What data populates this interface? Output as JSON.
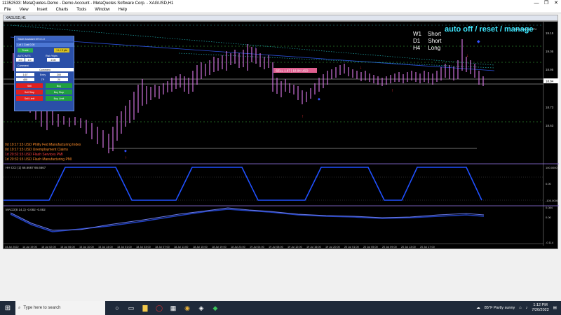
{
  "window": {
    "title": "11352533: MetaQuotes-Demo - Demo Account - MetaQuotes Software Corp. - XAGUSD,H1",
    "controls": [
      "—",
      "❐",
      "✕"
    ]
  },
  "menu": [
    "File",
    "View",
    "Insert",
    "Charts",
    "Tools",
    "Window",
    "Help"
  ],
  "chart": {
    "tab_title": "XAGUSD,H1",
    "trade_assist_label": "Trade Assistant MT4",
    "timeframes": [
      {
        "tf": "W1",
        "bias": "Short"
      },
      {
        "tf": "D1",
        "bias": "Short"
      },
      {
        "tf": "H4",
        "bias": "Long"
      }
    ],
    "auto_label": "auto off / reset / manage",
    "sell_label": "SELL 1.67 | 18.94 USD",
    "price_axis": [
      "19.15",
      "19.05",
      "18.95",
      "18.84",
      "18.73",
      "18.63"
    ],
    "current_price": "18.84",
    "cci_label": "HH CCI (1) 66.6667 66.6667",
    "cci_axis": [
      "100.0000",
      "0.00",
      "-100.0000"
    ],
    "macd_label": "MACD(8 14,1) -0.082 -0.082",
    "macd_axis": [
      "0.084",
      "0.00",
      "-0.114"
    ],
    "time_axis": [
      "14 Jul 2022",
      "14 Jul 19:00",
      "15 Jul 02:00",
      "15 Jul 06:00",
      "15 Jul 10:00",
      "15 Jul 14:00",
      "18 Jul 01:00",
      "18 Jul 03:00",
      "18 Jul 07:00",
      "18 Jul 11:00",
      "18 Jul 15:00",
      "18 Jul 19:00",
      "18 Jul 23:00",
      "19 Jul 04:00",
      "19 Jul 08:00",
      "19 Jul 12:00",
      "19 Jul 16:00",
      "19 Jul 20:00",
      "20 Jul 01:00",
      "20 Jul 05:00",
      "20 Jul 09:00",
      "20 Jul 13:00",
      "20 Jul 17:00"
    ]
  },
  "panel": {
    "title": "Trade Assistant MT4 1.0",
    "lot_label": "Lot 1  Cost 0.00",
    "trade_btn": "Trade",
    "lot_btn": "1 L / 2 pts",
    "sl_label": "AUTO  MTS",
    "risk_label": "Risk %/pts",
    "risk_val1": "2.0",
    "risk_val2": "1.0",
    "risk_val3": "2.00",
    "comment_label": "Comment",
    "comment_value": "Comment",
    "sl_val": "1.67",
    "entry_label": "Entry",
    "entry_val": "200",
    "tp_label": "TP",
    "tp_val": "400",
    "tp2_val": "20",
    "sell_btn": "Sell",
    "buy_btn": "Buy",
    "sell_stop_btn": "Sell Stop",
    "buy_stop_btn": "Buy Stop",
    "sell_limit_btn": "Sell Limit",
    "buy_limit_btn": "Buy Limit"
  },
  "news": [
    {
      "text": "0d 19:17:15  USD Philly Fed Manufacturing Index",
      "color": "#ff8c2a"
    },
    {
      "text": "0d 19:17:15  USD Unemployment Claims",
      "color": "#ff8c2a"
    },
    {
      "text": "1d 20:32:15  USD Flash Services PMI",
      "color": "#ff4040"
    },
    {
      "text": "1d 20:32:15  USD Flash Manufacturing PMI",
      "color": "#ff8c2a"
    }
  ],
  "taskbar": {
    "search_placeholder": "Type here to search",
    "weather": "85°F  Partly sunny",
    "time": "1:12 PM",
    "date": "7/20/2022"
  }
}
